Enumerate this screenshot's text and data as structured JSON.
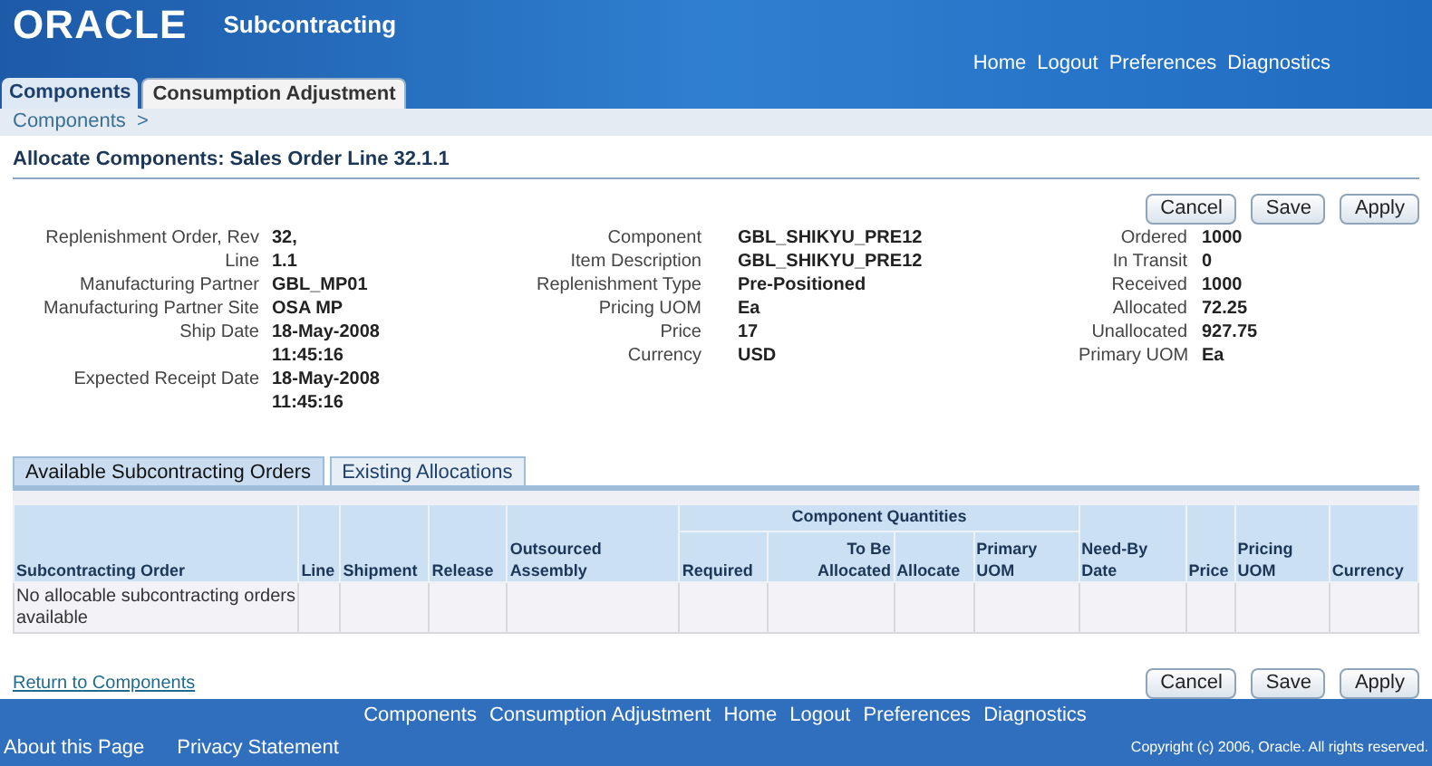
{
  "header": {
    "logo": "ORACLE",
    "app_title": "Subcontracting",
    "global_links": [
      "Home",
      "Logout",
      "Preferences",
      "Diagnostics"
    ]
  },
  "tabs": [
    {
      "label": "Components",
      "selected": true
    },
    {
      "label": "Consumption Adjustment",
      "selected": false
    }
  ],
  "breadcrumb": "Components  >",
  "page_title": "Allocate Components: Sales Order Line 32.1.1",
  "top_buttons": [
    "Cancel",
    "Save",
    "Apply"
  ],
  "details": [
    [
      {
        "label": "Replenishment Order, Rev",
        "value": "32,"
      },
      {
        "label": "Line",
        "value": "1.1"
      },
      {
        "label": "Manufacturing Partner",
        "value": "GBL_MP01"
      },
      {
        "label": "Manufacturing Partner Site",
        "value": "OSA MP"
      },
      {
        "label": "Ship Date",
        "value": "18-May-2008\n11:45:16"
      },
      {
        "label": "Expected Receipt Date",
        "value": "18-May-2008\n11:45:16"
      }
    ],
    [
      {
        "label": "Component",
        "value": "GBL_SHIKYU_PRE12"
      },
      {
        "label": "Item Description",
        "value": "GBL_SHIKYU_PRE12"
      },
      {
        "label": "Replenishment Type",
        "value": "Pre-Positioned"
      },
      {
        "label": "Pricing UOM",
        "value": "Ea"
      },
      {
        "label": "Price",
        "value": "17"
      },
      {
        "label": "Currency",
        "value": "USD"
      }
    ],
    [
      {
        "label": "Ordered",
        "value": "1000"
      },
      {
        "label": "In Transit",
        "value": "0"
      },
      {
        "label": "Received",
        "value": "1000"
      },
      {
        "label": "Allocated",
        "value": "72.25"
      },
      {
        "label": "Unallocated",
        "value": "927.75"
      },
      {
        "label": "Primary UOM",
        "value": "Ea"
      }
    ]
  ],
  "sub_tabs": [
    {
      "label": "Available Subcontracting Orders",
      "selected": true
    },
    {
      "label": "Existing Allocations",
      "selected": false
    }
  ],
  "table": {
    "group_label": "Component Quantities",
    "columns": [
      {
        "label": "Subcontracting Order",
        "grouped": false
      },
      {
        "label": "Line",
        "grouped": false
      },
      {
        "label": "Shipment",
        "grouped": false
      },
      {
        "label": "Release",
        "grouped": false
      },
      {
        "label": "Outsourced Assembly",
        "grouped": false
      },
      {
        "label": "Required",
        "grouped": true
      },
      {
        "label": "To Be Allocated",
        "grouped": true
      },
      {
        "label": "Allocate",
        "grouped": true
      },
      {
        "label": "Primary UOM",
        "grouped": true
      },
      {
        "label": "Need-By Date",
        "grouped": false
      },
      {
        "label": "Price",
        "grouped": false
      },
      {
        "label": "Pricing UOM",
        "grouped": false
      },
      {
        "label": "Currency",
        "grouped": false
      }
    ],
    "empty_message": "No allocable subcontracting orders available"
  },
  "return_link": "Return to Components",
  "bottom_buttons": [
    "Cancel",
    "Save",
    "Apply"
  ],
  "footer": {
    "links": [
      "Components",
      "Consumption Adjustment",
      "Home",
      "Logout",
      "Preferences",
      "Diagnostics"
    ],
    "about": "About this Page",
    "privacy": "Privacy Statement",
    "copyright": "Copyright (c) 2006, Oracle. All rights reserved."
  }
}
